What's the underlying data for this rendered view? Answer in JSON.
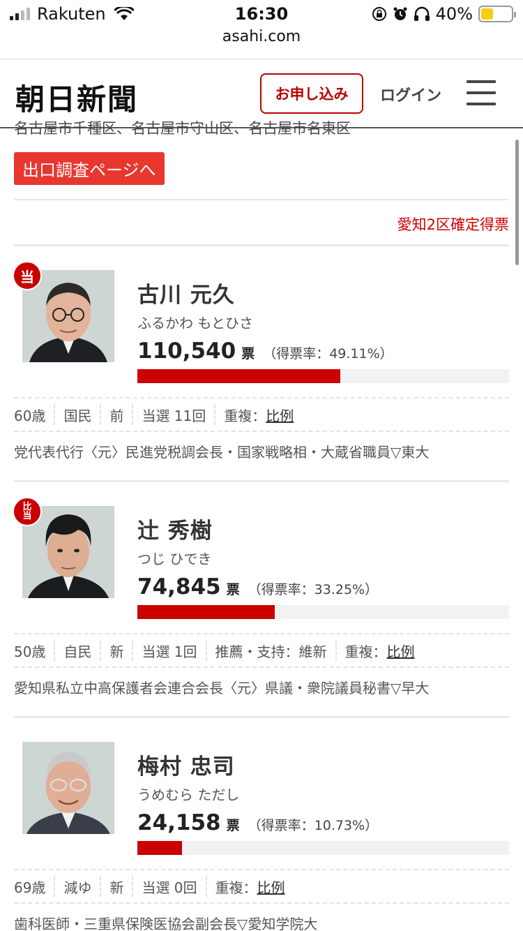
{
  "status_bar": {
    "carrier": "Rakuten",
    "time": "16:30",
    "battery": "40%",
    "battery_level": 0.4
  },
  "browser": {
    "url": "asahi.com"
  },
  "header": {
    "logo": "朝日新聞",
    "subscribe_label": "お申し込み",
    "login_label": "ログイン"
  },
  "page": {
    "cut_text": "名古屋市千種区、名古屋市守山区、名古屋市名東区",
    "exit_poll_button": "出口調査ページへ",
    "confirmed_label": "愛知2区確定得票"
  },
  "candidates": [
    {
      "badge": "当",
      "name": "古川 元久",
      "kana": "ふるかわ もとひさ",
      "votes": "110,540",
      "unit": "票",
      "rate": "（得票率：49.11%）",
      "share": 0.4911,
      "age": "60歳",
      "party": "国民",
      "status": "前",
      "elected": "当選 11回",
      "dual_prefix": "重複：",
      "dual_link": "比例",
      "career": "党代表代行〈元〉民進党税調会長・国家戦略相・大蔵省職員▽東大"
    },
    {
      "badge_top": "比",
      "badge_bottom": "当",
      "name": "辻 秀樹",
      "kana": "つじ ひでき",
      "votes": "74,845",
      "unit": "票",
      "rate": "（得票率：33.25%）",
      "share": 0.3325,
      "age": "50歳",
      "party": "自民",
      "status": "新",
      "elected": "当選 1回",
      "endorse": "推薦・支持：維新",
      "dual_prefix": "重複：",
      "dual_link": "比例",
      "career": "愛知県私立中高保護者会連合会長〈元〉県議・衆院議員秘書▽早大"
    },
    {
      "name": "梅村 忠司",
      "kana": "うめむら ただし",
      "votes": "24,158",
      "unit": "票",
      "rate": "（得票率：10.73%）",
      "share": 0.1073,
      "age": "69歳",
      "party": "減ゆ",
      "status": "新",
      "elected": "当選 0回",
      "dual_prefix": "重複：",
      "dual_link": "比例",
      "career": "歯科医師・三重県保険医協会副会長▽愛知学院大"
    }
  ]
}
